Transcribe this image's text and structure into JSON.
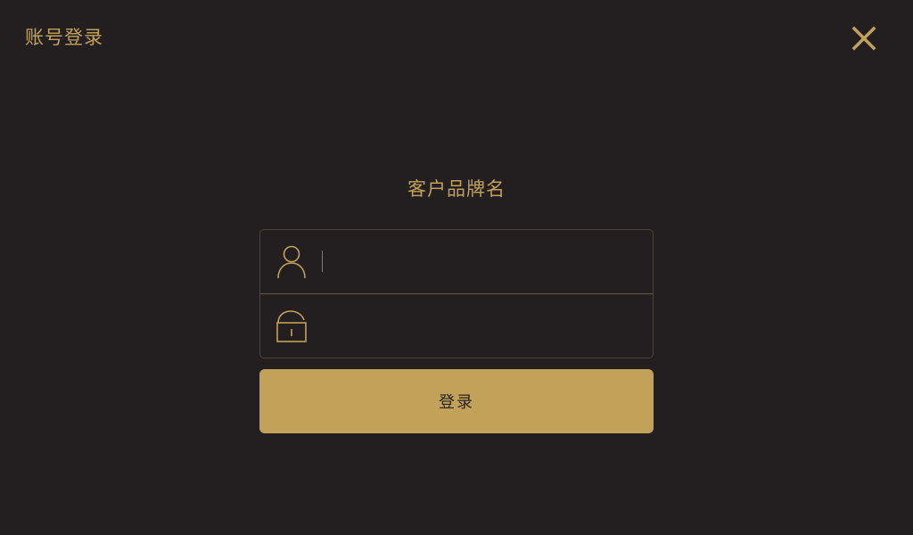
{
  "header": {
    "title": "账号登录",
    "close_icon": "close-icon"
  },
  "brand": {
    "name": "客户品牌名"
  },
  "form": {
    "username": {
      "icon": "user-icon",
      "value": "",
      "placeholder": ""
    },
    "password": {
      "icon": "unlock-icon",
      "value": "",
      "placeholder": ""
    },
    "submit_label": "登录"
  },
  "colors": {
    "background": "#231f20",
    "accent": "#c2a158",
    "button_text": "#2a2420"
  }
}
